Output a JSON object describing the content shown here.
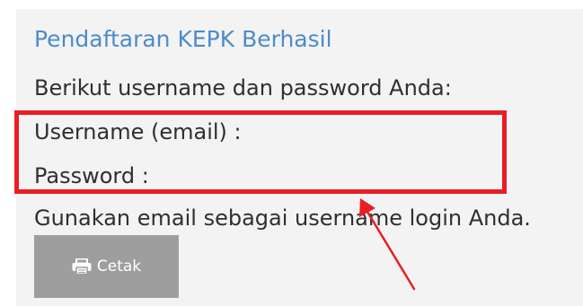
{
  "dialog": {
    "title": "Pendaftaran KEPK Berhasil",
    "intro_text": "Berikut username dan password Anda:",
    "username_label": "Username (email) :",
    "password_label": "Password :",
    "hint_text": "Gunakan email sebagai username login Anda."
  },
  "toolbar": {
    "print_label": "Cetak",
    "print_icon": "printer-icon"
  },
  "annotation": {
    "highlight_color": "#e81e25",
    "arrow_color": "#e81e25"
  },
  "colors": {
    "title": "#4d8bcb",
    "body_text": "#2f2f2f",
    "panel_background": "#f3f3f3",
    "button_background": "#9e9e9e"
  }
}
